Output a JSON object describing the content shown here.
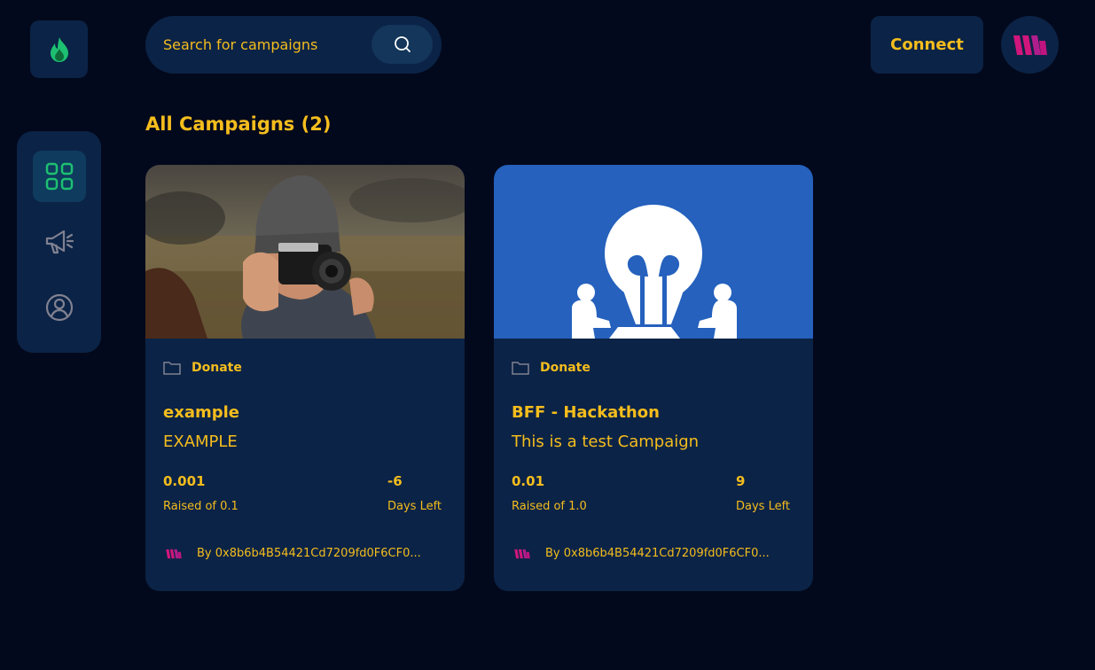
{
  "colors": {
    "background": "#03091c",
    "panel": "#0b2346",
    "accent": "#f5bd1d",
    "active": "#0f3b5e",
    "green": "#1dc071",
    "brand": "#d0167c"
  },
  "search": {
    "placeholder": "Search for campaigns"
  },
  "header": {
    "connect_label": "Connect"
  },
  "sidebar": {
    "items": [
      {
        "icon": "dashboard-icon",
        "active": true
      },
      {
        "icon": "megaphone-icon",
        "active": false
      },
      {
        "icon": "profile-icon",
        "active": false
      }
    ]
  },
  "main": {
    "heading": "All Campaigns (2)",
    "campaigns": [
      {
        "category": "Donate",
        "title": "example",
        "description": "EXAMPLE",
        "raised": "0.001",
        "raised_label": "Raised of 0.1",
        "days": "-6",
        "days_label": "Days Left",
        "owner": "By 0x8b6b4B54421Cd7209fd0F6CF0..."
      },
      {
        "category": "Donate",
        "title": "BFF - Hackathon",
        "description": "This is a test Campaign",
        "raised": "0.01",
        "raised_label": "Raised of 1.0",
        "days": "9",
        "days_label": "Days Left",
        "owner": "By 0x8b6b4B54421Cd7209fd0F6CF0..."
      }
    ]
  }
}
